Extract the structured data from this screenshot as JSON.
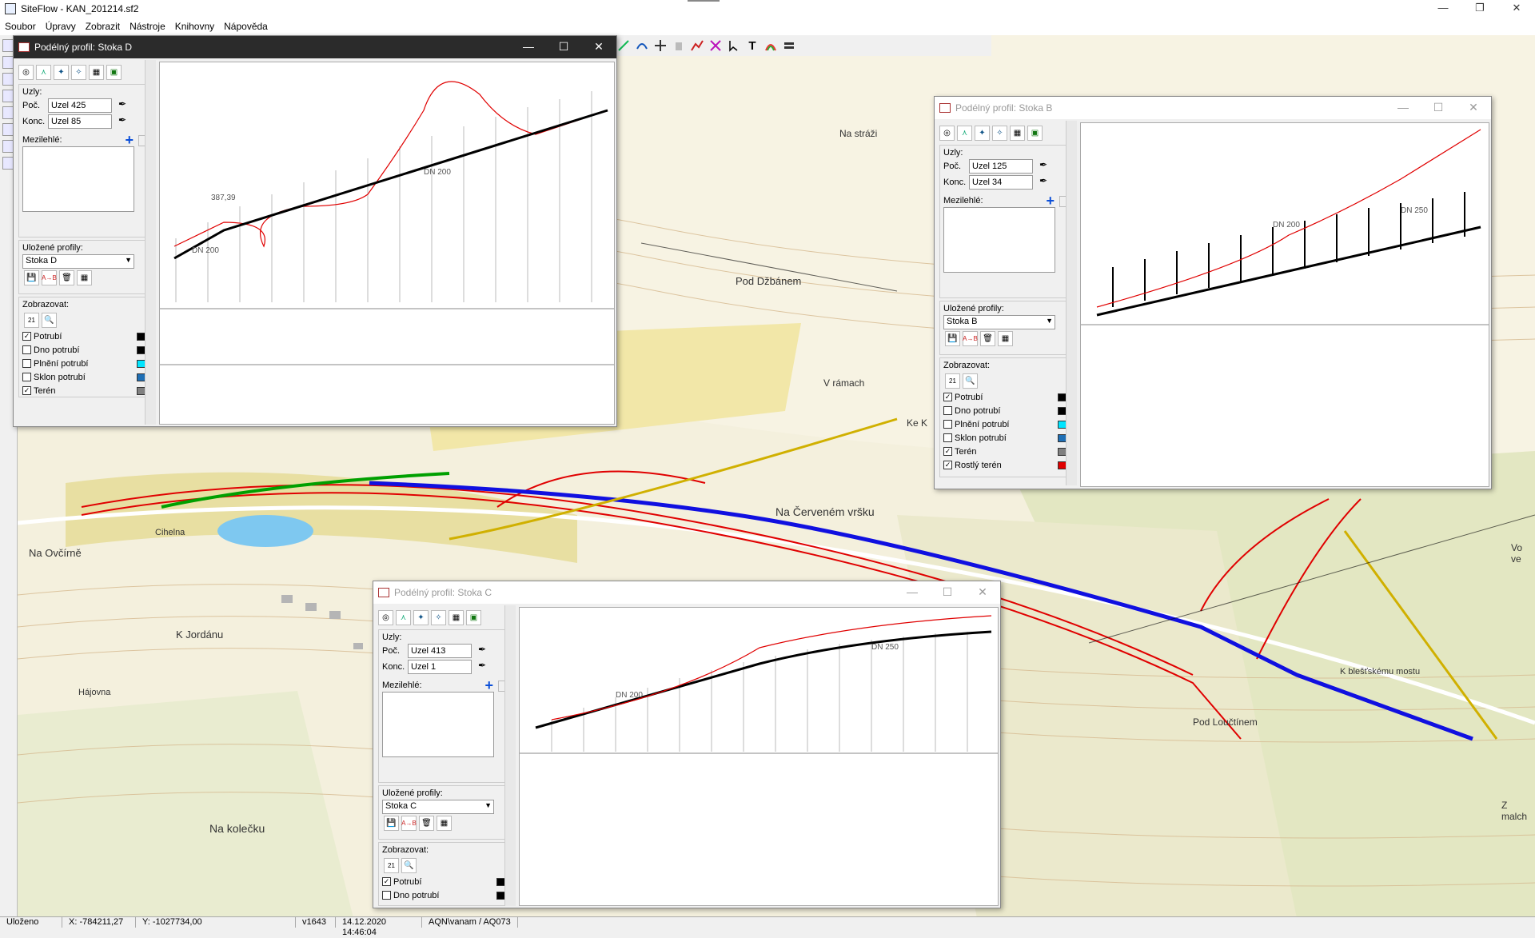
{
  "app": {
    "title": "SiteFlow - KAN_201214.sf2"
  },
  "menu": [
    "Soubor",
    "Úpravy",
    "Zobrazit",
    "Nástroje",
    "Knihovny",
    "Nápověda"
  ],
  "status": {
    "state": "Uloženo",
    "x": "X: -784211,27",
    "y": "Y: -1027734,00",
    "version": "v1643",
    "datetime": "14.12.2020 14:46:04",
    "user": "AQN\\vanam / AQ073"
  },
  "map_labels": [
    "Pod Džbánem",
    "Na stráži",
    "Pod Loučtínem",
    "Na kolečku",
    "K Jordánu",
    "Na Ovčírně",
    "Cihelna",
    "Na Červeném vršku",
    "Hájovna",
    "K blešťskému mostu",
    "V rámach",
    "Ke K",
    "Vo ve",
    "Z malch"
  ],
  "windows": [
    {
      "id": "D",
      "title": "Podélný profil: Stoka D",
      "start": "Uzel 425",
      "end": "Uzel 85",
      "saved": "Stoka D"
    },
    {
      "id": "B",
      "title": "Podélný profil: Stoka B",
      "start": "Uzel 125",
      "end": "Uzel 34",
      "saved": "Stoka B"
    },
    {
      "id": "C",
      "title": "Podélný profil: Stoka C",
      "start": "Uzel 413",
      "end": "Uzel 1",
      "saved": "Stoka C"
    }
  ],
  "labels": {
    "nodes": "Uzly:",
    "start": "Poč.",
    "end": "Konc.",
    "mid": "Mezilehlé:",
    "saved_profiles": "Uložené profily:",
    "show": "Zobrazovat:"
  },
  "legend": [
    {
      "label": "Potrubí",
      "checked": true,
      "color": "#000000"
    },
    {
      "label": "Dno potrubí",
      "checked": false,
      "color": "#000000"
    },
    {
      "label": "Plnění potrubí",
      "checked": false,
      "color": "#00e5ff"
    },
    {
      "label": "Sklon potrubí",
      "checked": false,
      "color": "#1f6fb5"
    },
    {
      "label": "Terén",
      "checked": true,
      "color": "#808080"
    },
    {
      "label": "Rostlý terén",
      "checked": true,
      "color": "#e00000"
    }
  ],
  "profile_text": {
    "pipe_label": "DN 200",
    "pipe_label2": "DN 250",
    "elev": "387,39"
  }
}
